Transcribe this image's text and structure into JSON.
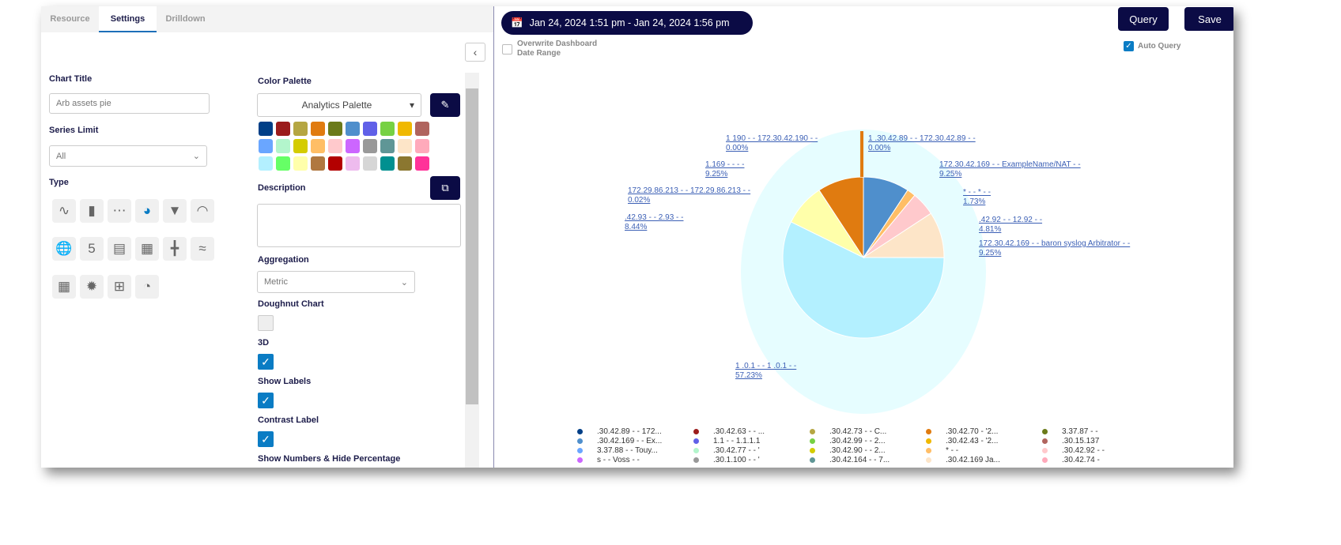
{
  "tabs": [
    "Resource",
    "Settings",
    "Drilldown"
  ],
  "settings": {
    "chart_title_label": "Chart Title",
    "chart_title_value": "Arb assets pie",
    "series_limit_label": "Series Limit",
    "series_limit_value": "All",
    "type_label": "Type",
    "type_icons": [
      "line-chart",
      "bar-chart",
      "scatter-chart",
      "pie-chart",
      "funnel-chart",
      "gauge-chart",
      "map-chart",
      "number-5",
      "table",
      "device",
      "sip",
      "trend",
      "grid",
      "sunburst",
      "pivot-table",
      "pie-bar"
    ],
    "selected_type": "pie-chart",
    "color_palette_label": "Color Palette",
    "color_palette_value": "Analytics Palette",
    "palette": [
      "#003f87",
      "#9b1c1c",
      "#b5a642",
      "#e07b10",
      "#6b7a1a",
      "#4f8fcc",
      "#6060e8",
      "#77d144",
      "#f0b800",
      "#b0645e",
      "#6aa6ff",
      "#b3f5cc",
      "#d4cc00",
      "#ffbe66",
      "#ffc9cc",
      "#cc66ff",
      "#999999",
      "#5f9696",
      "#fde5c8",
      "#ffaabb",
      "#b3f0ff",
      "#66ff66",
      "#ffffaa",
      "#b07840",
      "#b30000",
      "#eebbee",
      "#d6d6d6",
      "#009090",
      "#8b7730",
      "#ff3399"
    ],
    "description_label": "Description",
    "description_value": "",
    "aggregation_label": "Aggregation",
    "aggregation_value": "Metric",
    "doughnut_label": "Doughnut Chart",
    "doughnut_checked": false,
    "three_d_label": "3D",
    "three_d_checked": true,
    "show_labels_label": "Show Labels",
    "show_labels_checked": true,
    "contrast_label": "Contrast Label",
    "contrast_checked": true,
    "show_numbers_label": "Show Numbers & Hide Percentage"
  },
  "header": {
    "date_range": "Jan 24, 2024 1:51 pm - Jan 24, 2024 1:56 pm",
    "overwrite_label": "Overwrite Dashboard Date Range",
    "overwrite_checked": false,
    "query_label": "Query",
    "save_label": "Save",
    "auto_query_label": "Auto Query",
    "auto_query_checked": true
  },
  "chart_data": {
    "type": "pie",
    "three_d": true,
    "slices": [
      {
        "label": "1 .30.42.89 - - 172.30.42.89 - -",
        "value": 0.0,
        "pct": "0.00%",
        "color": "#6aa6ff"
      },
      {
        "label": "172.30.42.169 - - ExampleName/NAT - -",
        "value": 9.25,
        "pct": "9.25%",
        "color": "#4f8fcc"
      },
      {
        "label": "* - - * - -",
        "value": 1.73,
        "pct": "1.73%",
        "color": "#ffbe66"
      },
      {
        "label": ".42.92 - - 12.92 - -",
        "value": 4.81,
        "pct": "4.81%",
        "color": "#ffc9cc"
      },
      {
        "label": "172.30.42.169 - - baron syslog Arbitrator - -",
        "value": 9.25,
        "pct": "9.25%",
        "color": "#fde5c8"
      },
      {
        "label": "1 .0.1 - - 1 .0.1 - -",
        "value": 57.23,
        "pct": "57.23%",
        "color": "#b3f0ff"
      },
      {
        "label": ".42.93 - - 2.93 - -",
        "value": 8.44,
        "pct": "8.44%",
        "color": "#ffffaa"
      },
      {
        "label": "172.29.86.213 - - 172.29.86.213 - -",
        "value": 0.02,
        "pct": "0.02%",
        "color": "#5f9696"
      },
      {
        "label": "1.169 - - - -",
        "value": 9.25,
        "pct": "9.25%",
        "color": "#e07b10"
      },
      {
        "label": "1 190 - - 172.30.42.190 - -",
        "value": 0.0,
        "pct": "0.00%",
        "color": "#ffbe66"
      }
    ]
  },
  "legend": [
    {
      "text": ".30.42.89 - - 172...",
      "color": "#003f87"
    },
    {
      "text": ".30.42.63 - -   ...",
      "color": "#9b1c1c"
    },
    {
      "text": ".30.42.73 - -   C...",
      "color": "#b5a642"
    },
    {
      "text": ".30.42.70 -   '2...",
      "color": "#e07b10"
    },
    {
      "text": "3.37.87 - -",
      "color": "#6b7a1a"
    },
    {
      "text": ".30.42.169 - - Ex...",
      "color": "#4f8fcc"
    },
    {
      "text": "1.1 - - 1.1.1.1",
      "color": "#6060e8"
    },
    {
      "text": ".30.42.99 - -   2...",
      "color": "#77d144"
    },
    {
      "text": ".30.42.43 -   '2...",
      "color": "#f0b800"
    },
    {
      "text": ".30.15.137",
      "color": "#b0645e"
    },
    {
      "text": "3.37.88 - - Touy...",
      "color": "#6aa6ff"
    },
    {
      "text": ".30.42.77 - -  '",
      "color": "#b3f5cc"
    },
    {
      "text": ".30.42.90 - -   2...",
      "color": "#d4cc00"
    },
    {
      "text": "* - -",
      "color": "#ffbe66"
    },
    {
      "text": ".30.42.92 - -",
      "color": "#ffc9cc"
    },
    {
      "text": "s - - Voss - -",
      "color": "#cc66ff"
    },
    {
      "text": ".30.1.100 - -  '",
      "color": "#999999"
    },
    {
      "text": ".30.42.164 - -   7...",
      "color": "#5f9696"
    },
    {
      "text": ".30.42.169   Ja...",
      "color": "#fde5c8"
    },
    {
      "text": ".30.42.74 -",
      "color": "#ffaabb"
    }
  ]
}
